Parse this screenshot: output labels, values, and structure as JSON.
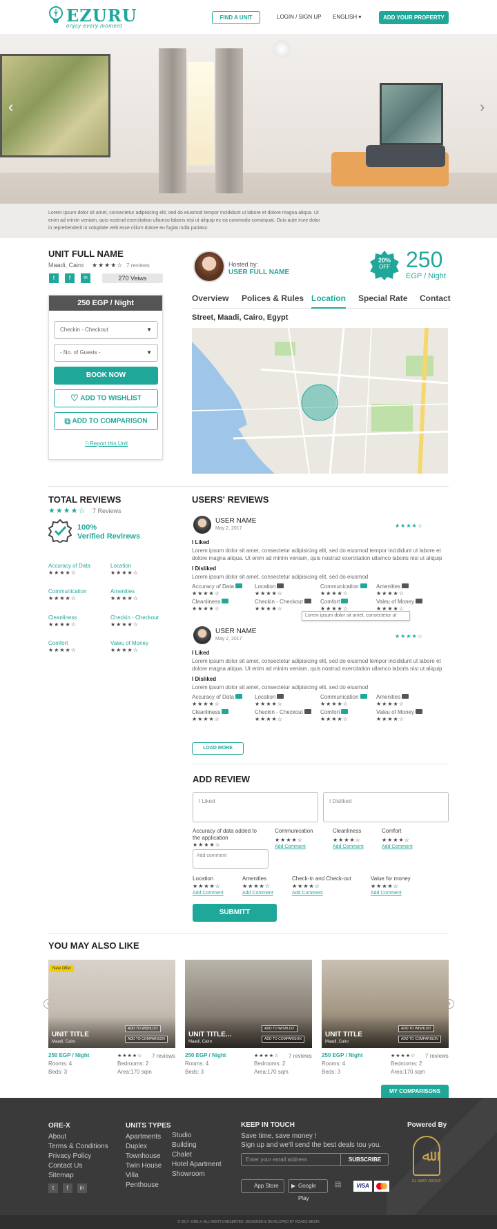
{
  "header": {
    "logo_text": "EZURU",
    "logo_tagline": "enjoy every moment",
    "find_unit": "FIND A UNIT",
    "login": "LOGIN / SIGN UP",
    "language": "ENGLISH",
    "add_property": "ADD YOUR PROPERTY"
  },
  "hero": {
    "caption": "Lorem ipsum dolor sit amet, consectetur adipisicing elit, sed do eiusmod tempor incididunt ut labore et dolore magna aliqua. Ut enim ad minim veniam, quis nostrud exercitation ullamco laboris nisi ut aliquip ex ea commodo consequat. Duis aute irure dolor in reprehenderit in voluptate velit esse cillum dolore eu fugiat nulla pariatur."
  },
  "unit": {
    "name": "UNIT FULL NAME",
    "location": "Maadi, Cairo",
    "stars": "★★★★☆",
    "reviews": "7 reviews",
    "views": "270 Veiws",
    "price_header": "250 EGP / Night",
    "checkin_placeholder": "Checkin - Checkout",
    "guests_placeholder": "- No. of Guests -",
    "book_now": "BOOK NOW",
    "add_wishlist": "ADD TO WISHLIST",
    "add_comparison": "ADD TO COMPARISON",
    "report": "Report this Unit"
  },
  "host": {
    "hosted_by": "Hosted by:",
    "name": "USER FULL NAME"
  },
  "price_badge": {
    "discount": "20%",
    "off": "OFF",
    "amount": "250",
    "unit": "EGP / Night"
  },
  "tabs": [
    "Overview",
    "Polices & Rules",
    "Location",
    "Special Rate",
    "Contact"
  ],
  "location": {
    "address": "Street, Maadi, Cairo, Egypt"
  },
  "total_reviews": {
    "title": "TOTAL REVIEWS",
    "stars": "★★★★☆",
    "count": "7 Reviews",
    "verified_pct": "100%",
    "verified_label": "Verified Revirews",
    "categories": [
      {
        "label": "Accuracy of Data",
        "stars": "★★★★☆"
      },
      {
        "label": "Location",
        "stars": "★★★★☆"
      },
      {
        "label": "Communication",
        "stars": "★★★★☆"
      },
      {
        "label": "Amenities",
        "stars": "★★★★☆"
      },
      {
        "label": "Cleanliness",
        "stars": "★★★★☆"
      },
      {
        "label": "Checkin - Checkout",
        "stars": "★★★★☆"
      },
      {
        "label": "Comfort",
        "stars": "★★★★☆"
      },
      {
        "label": "Valeu of Money",
        "stars": "★★★★☆"
      }
    ]
  },
  "users_reviews": {
    "title": "USERS' REVIEWS",
    "items": [
      {
        "name": "USER NAME",
        "date": "May 2, 2017",
        "stars": "★★★★☆",
        "liked_label": "I Liked",
        "liked_text": "Lorem ipsum dolor sit amet, consectetur adipisicing elit, sed do eiusmod tempor incididunt ut labore et dolore magna aliqua. Ut enim ad minim veniam, quis nostrud exercitation ullamco laboris nisi ut aliquip",
        "disliked_label": "I Disliked",
        "disliked_text": "Lorem ipsum dolor sit amet, consectetur adipisicing elit, sed do eiusmod",
        "tooltip": "Lorem ipsum dolor sit amet, consectetur ut"
      },
      {
        "name": "USER NAME",
        "date": "May 2, 2017",
        "stars": "★★★★☆",
        "liked_label": "I Liked",
        "liked_text": "Lorem ipsum dolor sit amet, consectetur adipisicing elit, sed do eiusmod tempor incididunt ut labore et dolore magna aliqua. Ut enim ad minim veniam, quis nostrud exercitation ullamco laboris nisi ut aliquip",
        "disliked_label": "I Disliked",
        "disliked_text": "Lorem ipsum dolor sit amet, consectetur adipisicing elit, sed do eiusmod"
      }
    ],
    "cat_labels": [
      "Accuracy of Data",
      "Location",
      "Communication",
      "Amenities",
      "Cleanliness",
      "Checkin - Checkout",
      "Comfort",
      "Valeu of Money"
    ],
    "cat_stars": "★★★★☆",
    "load_more": "LOAD MORE"
  },
  "add_review": {
    "title": "ADD REVIEW",
    "liked_placeholder": "I Liked",
    "disliked_placeholder": "I Disliked",
    "row1": [
      {
        "label": "Accuracy of data added to the application",
        "stars": "★★★★☆"
      },
      {
        "label": "Communication",
        "stars": "★★★★☆",
        "link": "Add Comment"
      },
      {
        "label": "Cleanliness",
        "stars": "★★★★☆",
        "link": "Add Comment"
      },
      {
        "label": "Comfort",
        "stars": "★★★★☆",
        "link": "Add Comment"
      }
    ],
    "comment_placeholder": "Add comment",
    "row2": [
      {
        "label": "Location",
        "stars": "★★★★☆",
        "link": "Add Comment"
      },
      {
        "label": "Amenities",
        "stars": "★★★★☆",
        "link": "Add Comment"
      },
      {
        "label": "Check-in and Check-out",
        "stars": "★★★★☆",
        "link": "Add Comment"
      },
      {
        "label": "Value for money",
        "stars": "★★★★☆",
        "link": "Add Comment"
      }
    ],
    "submit": "SUBMITT"
  },
  "similar": {
    "title": "YOU MAY ALSO LIKE",
    "new_offer": "New Offer",
    "wishlist": "ADD TO WISHLIST",
    "comparison": "ADD TO COMPARISON",
    "cards": [
      {
        "title": "UNIT TITLE",
        "loc": "Maadi, Cairo",
        "price": "250 EGP / Night",
        "stars": "★★★★☆",
        "reviews": "7 reviews",
        "rooms": "Rooms: 4",
        "bedrooms": "Bedrooms: 2",
        "beds": "Beds: 3",
        "area": "Area:170 sqm"
      },
      {
        "title": "UNIT TITLE...",
        "loc": "Maadi, Cairo",
        "price": "250 EGP / Night",
        "stars": "★★★★☆",
        "reviews": "7 reviews",
        "rooms": "Rooms: 4",
        "bedrooms": "Bedrooms: 2",
        "beds": "Beds: 3",
        "area": "Area:170 sqm"
      },
      {
        "title": "UNIT TITLE",
        "loc": "Maadi, Cairo",
        "price": "250 EGP / Night",
        "stars": "★★★★☆",
        "reviews": "7 reviews",
        "rooms": "Rooms: 4",
        "bedrooms": "Bedrooms: 2",
        "beds": "Beds: 3",
        "area": "Area:170 sqm"
      }
    ],
    "my_comparisons": "MY COMPARISONS"
  },
  "footer": {
    "col1_title": "ORE-X",
    "col1": [
      "About",
      "Terms & Conditions",
      "Privacy Policy",
      "Contact Us",
      "Sitemap"
    ],
    "col2_title": "UNITS TYPES",
    "col2a": [
      "Apartments",
      "Duplex",
      "Townhouse",
      "Twin House",
      "Villa",
      "Penthouse"
    ],
    "col2b": [
      "Studio",
      "Building",
      "Chalet",
      "Hotel Apartment",
      "Showroom"
    ],
    "col3_title": "KEEP IN TOUCH",
    "col3_line1": "Save time, save money !",
    "col3_line2": "Sign up and we'll send the best deals tou you.",
    "email_placeholder": "Enter your email address",
    "subscribe": "SUBSCRIBE",
    "app_store": "App Store",
    "google_play": "Google Play",
    "visa": "VISA",
    "powered_by": "Powered By",
    "group_name": "EL SAWY GROUP",
    "copyright": "© 2017- ORE-X. ALL RIGHTS RESERVED. DESIGNED & DEVELOPED BY ROADS MEDIA"
  },
  "colors": {
    "accent": "#1fa89a",
    "footer_bg": "#3a3a3a"
  }
}
